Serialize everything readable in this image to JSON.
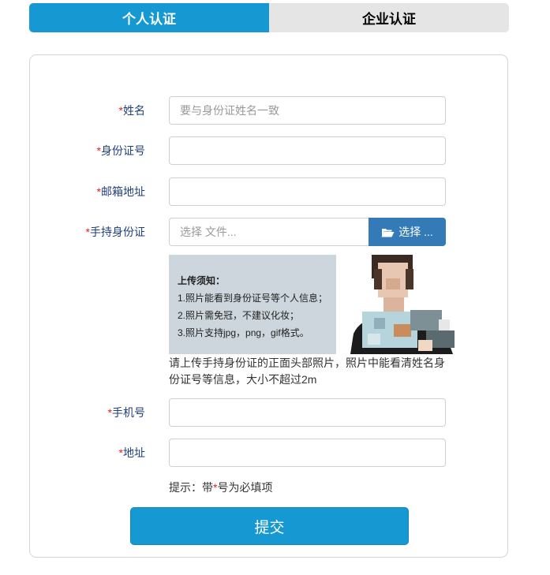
{
  "tabs": {
    "personal": "个人认证",
    "enterprise": "企业认证"
  },
  "form": {
    "required_mark": "*",
    "name": {
      "label": "姓名",
      "placeholder": "要与身份证姓名一致",
      "value": ""
    },
    "id_number": {
      "label": "身份证号",
      "value": ""
    },
    "email": {
      "label": "邮箱地址",
      "value": ""
    },
    "id_photo": {
      "label": "手持身份证",
      "file_placeholder": "选择 文件...",
      "button_label": "选择 ...",
      "button_icon": "folder-open-icon"
    },
    "upload_notice": {
      "title": "上传须知：",
      "lines": [
        "1.照片能看到身份证号等个人信息；",
        "2.照片需免冠，不建议化妆；",
        "3.照片支持jpg，png，gif格式。"
      ]
    },
    "help_text": "请上传手持身份证的正面头部照片，照片中能看清姓名身份证号等信息，大小不超过2m",
    "phone": {
      "label": "手机号",
      "value": ""
    },
    "address": {
      "label": "地址",
      "value": ""
    },
    "hint_prefix": "提示：带",
    "hint_suffix": "号为必填项",
    "submit_label": "提交"
  },
  "colors": {
    "primary": "#1699d2",
    "file_button": "#337ab7",
    "label": "#1f3f7a",
    "required": "#e02020"
  }
}
